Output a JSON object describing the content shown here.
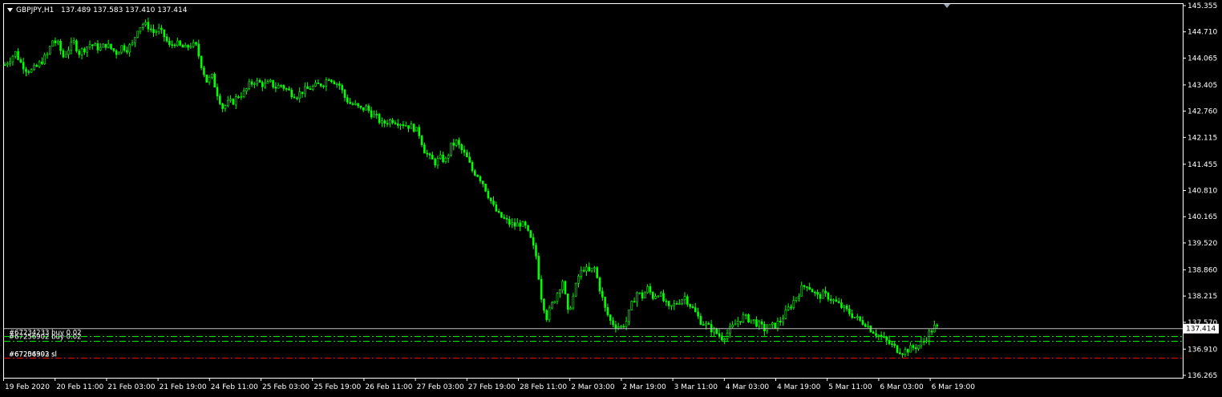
{
  "header": {
    "symbol": "GBPJPY,H1",
    "ohlc": "137.489 137.583 137.410 137.414"
  },
  "colors": {
    "background": "#000000",
    "candle_up": "#00ff00",
    "candle_down": "#00ff00",
    "axis": "#ffffff",
    "order_line": "#00ff00",
    "sl_line": "#ff0000",
    "bid_line": "#c0c0c0"
  },
  "orders": [
    {
      "label": "#67234233 buy 0.02",
      "price": 137.22
    },
    {
      "label": "#67256902 buy 0.02",
      "price": 137.1
    },
    {
      "label": "#67204393 sl",
      "price": 136.69
    },
    {
      "label": "#67256902 sl",
      "price": 136.69
    }
  ],
  "current_price_label": "137.414",
  "chart_data": {
    "type": "candlestick",
    "ylim": [
      136.265,
      145.355
    ],
    "y_ticks": [
      "145.355",
      "144.710",
      "144.065",
      "143.405",
      "142.760",
      "142.115",
      "141.455",
      "140.810",
      "140.165",
      "139.520",
      "138.860",
      "138.215",
      "137.570",
      "136.910",
      "136.265"
    ],
    "x_ticks": [
      "19 Feb 2020",
      "20 Feb 11:00",
      "21 Feb 03:00",
      "21 Feb 19:00",
      "24 Feb 11:00",
      "25 Feb 03:00",
      "25 Feb 19:00",
      "26 Feb 11:00",
      "27 Feb 03:00",
      "27 Feb 19:00",
      "28 Feb 11:00",
      "2 Mar 03:00",
      "2 Mar 19:00",
      "3 Mar 11:00",
      "4 Mar 03:00",
      "4 Mar 19:00",
      "5 Mar 11:00",
      "6 Mar 03:00",
      "6 Mar 19:00"
    ],
    "close_path": [
      [
        0,
        143.9
      ],
      [
        2,
        144.05
      ],
      [
        4,
        144.2
      ],
      [
        6,
        143.95
      ],
      [
        8,
        143.8
      ],
      [
        10,
        143.75
      ],
      [
        12,
        143.85
      ],
      [
        14,
        144.0
      ],
      [
        16,
        144.15
      ],
      [
        18,
        144.5
      ],
      [
        20,
        144.4
      ],
      [
        22,
        144.1
      ],
      [
        24,
        144.3
      ],
      [
        26,
        144.45
      ],
      [
        28,
        144.2
      ],
      [
        30,
        144.3
      ],
      [
        32,
        144.4
      ],
      [
        34,
        144.35
      ],
      [
        36,
        144.3
      ],
      [
        38,
        144.4
      ],
      [
        40,
        144.3
      ],
      [
        42,
        144.2
      ],
      [
        44,
        144.35
      ],
      [
        46,
        144.3
      ],
      [
        48,
        144.4
      ],
      [
        50,
        144.8
      ],
      [
        52,
        144.9
      ],
      [
        54,
        144.85
      ],
      [
        56,
        144.7
      ],
      [
        58,
        144.75
      ],
      [
        60,
        144.6
      ],
      [
        62,
        144.35
      ],
      [
        64,
        144.45
      ],
      [
        66,
        144.35
      ],
      [
        68,
        144.3
      ],
      [
        70,
        144.4
      ],
      [
        72,
        144.35
      ],
      [
        74,
        143.9
      ],
      [
        76,
        143.5
      ],
      [
        78,
        143.6
      ],
      [
        80,
        143.2
      ],
      [
        82,
        142.85
      ],
      [
        84,
        142.95
      ],
      [
        86,
        143.0
      ],
      [
        88,
        143.15
      ],
      [
        90,
        143.2
      ],
      [
        92,
        143.4
      ],
      [
        94,
        143.5
      ],
      [
        96,
        143.45
      ],
      [
        98,
        143.4
      ],
      [
        100,
        143.45
      ],
      [
        102,
        143.35
      ],
      [
        104,
        143.4
      ],
      [
        106,
        143.3
      ],
      [
        108,
        143.2
      ],
      [
        110,
        143.15
      ],
      [
        112,
        143.25
      ],
      [
        114,
        143.3
      ],
      [
        116,
        143.35
      ],
      [
        118,
        143.4
      ],
      [
        120,
        143.45
      ],
      [
        122,
        143.6
      ],
      [
        124,
        143.5
      ],
      [
        126,
        143.4
      ],
      [
        128,
        143.1
      ],
      [
        130,
        142.95
      ],
      [
        132,
        142.9
      ],
      [
        134,
        142.8
      ],
      [
        136,
        142.85
      ],
      [
        138,
        142.7
      ],
      [
        140,
        142.6
      ],
      [
        142,
        142.45
      ],
      [
        144,
        142.5
      ],
      [
        146,
        142.55
      ],
      [
        148,
        142.5
      ],
      [
        150,
        142.45
      ],
      [
        152,
        142.4
      ],
      [
        154,
        142.35
      ],
      [
        156,
        142.2
      ],
      [
        158,
        141.8
      ],
      [
        160,
        141.6
      ],
      [
        162,
        141.5
      ],
      [
        164,
        141.6
      ],
      [
        166,
        141.55
      ],
      [
        168,
        141.9
      ],
      [
        170,
        142.0
      ],
      [
        172,
        141.8
      ],
      [
        174,
        141.6
      ],
      [
        176,
        141.3
      ],
      [
        178,
        141.2
      ],
      [
        180,
        141.0
      ],
      [
        182,
        140.7
      ],
      [
        184,
        140.4
      ],
      [
        186,
        140.2
      ],
      [
        188,
        140.1
      ],
      [
        190,
        140.0
      ],
      [
        192,
        139.95
      ],
      [
        194,
        140.0
      ],
      [
        196,
        139.9
      ],
      [
        198,
        139.6
      ],
      [
        200,
        139.2
      ],
      [
        202,
        138.2
      ],
      [
        204,
        137.7
      ],
      [
        206,
        138.0
      ],
      [
        208,
        138.3
      ],
      [
        210,
        138.6
      ],
      [
        212,
        137.8
      ],
      [
        214,
        138.2
      ],
      [
        216,
        138.7
      ],
      [
        218,
        138.9
      ],
      [
        220,
        138.8
      ],
      [
        222,
        138.9
      ],
      [
        224,
        138.4
      ],
      [
        226,
        137.9
      ],
      [
        228,
        137.6
      ],
      [
        230,
        137.5
      ],
      [
        232,
        137.45
      ],
      [
        234,
        137.6
      ],
      [
        236,
        138.0
      ],
      [
        238,
        138.3
      ],
      [
        240,
        138.2
      ],
      [
        242,
        138.4
      ],
      [
        244,
        138.2
      ],
      [
        246,
        138.3
      ],
      [
        248,
        138.1
      ],
      [
        250,
        137.9
      ],
      [
        252,
        138.0
      ],
      [
        254,
        138.1
      ],
      [
        256,
        138.2
      ],
      [
        258,
        138.0
      ],
      [
        260,
        137.8
      ],
      [
        262,
        137.6
      ],
      [
        264,
        137.5
      ],
      [
        266,
        137.4
      ],
      [
        268,
        137.3
      ],
      [
        270,
        137.2
      ],
      [
        272,
        137.3
      ],
      [
        274,
        137.45
      ],
      [
        276,
        137.6
      ],
      [
        278,
        137.7
      ],
      [
        280,
        137.65
      ],
      [
        282,
        137.6
      ],
      [
        284,
        137.5
      ],
      [
        286,
        137.4
      ],
      [
        288,
        137.45
      ],
      [
        290,
        137.5
      ],
      [
        292,
        137.6
      ],
      [
        294,
        137.8
      ],
      [
        296,
        138.0
      ],
      [
        298,
        138.2
      ],
      [
        300,
        138.4
      ],
      [
        302,
        138.5
      ],
      [
        304,
        138.35
      ],
      [
        306,
        138.2
      ],
      [
        308,
        138.25
      ],
      [
        310,
        138.2
      ],
      [
        312,
        138.1
      ],
      [
        314,
        138.0
      ],
      [
        316,
        137.9
      ],
      [
        318,
        137.8
      ],
      [
        320,
        137.7
      ],
      [
        322,
        137.6
      ],
      [
        324,
        137.55
      ],
      [
        326,
        137.4
      ],
      [
        328,
        137.3
      ],
      [
        330,
        137.2
      ],
      [
        332,
        137.1
      ],
      [
        334,
        137.0
      ],
      [
        336,
        136.9
      ],
      [
        338,
        136.85
      ],
      [
        340,
        136.9
      ],
      [
        342,
        136.95
      ],
      [
        344,
        137.0
      ],
      [
        346,
        137.1
      ],
      [
        348,
        137.3
      ],
      [
        350,
        137.45
      ],
      [
        352,
        137.41
      ]
    ]
  }
}
